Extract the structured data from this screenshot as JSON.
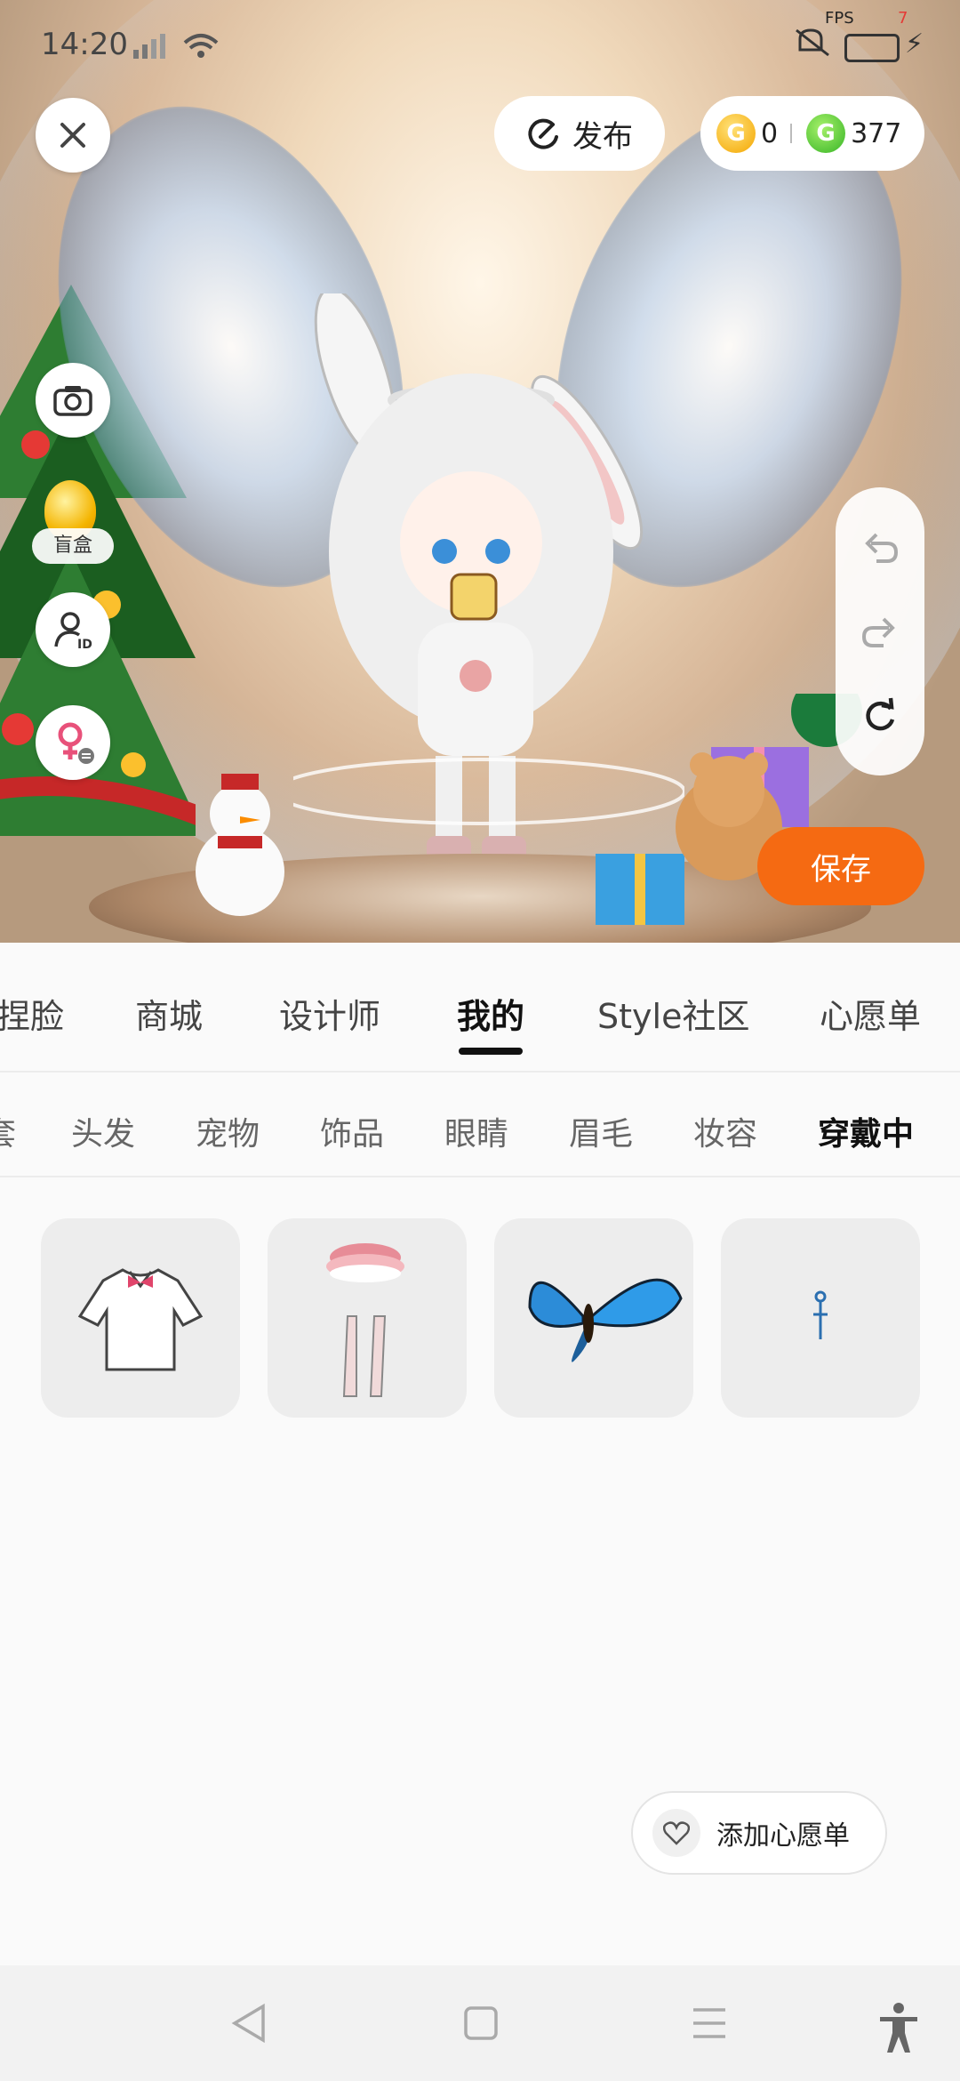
{
  "status_bar": {
    "time": "14:20",
    "fps_label": "FPS",
    "fps_value": "7"
  },
  "top_bar": {
    "publish_label": "发布",
    "gold_coin_value": "0",
    "green_coin_value": "377",
    "gold_coin_glyph": "G",
    "green_coin_glyph": "G"
  },
  "left_tools": {
    "blind_box_label": "盲盒"
  },
  "save_label": "保存",
  "main_tabs": [
    {
      "label": "捏脸"
    },
    {
      "label": "商城"
    },
    {
      "label": "设计师"
    },
    {
      "label": "我的"
    },
    {
      "label": "Style社区"
    },
    {
      "label": "心愿单"
    }
  ],
  "active_main_tab": "我的",
  "sub_tabs": [
    {
      "label": "套"
    },
    {
      "label": "头发"
    },
    {
      "label": "宠物"
    },
    {
      "label": "饰品"
    },
    {
      "label": "眼睛"
    },
    {
      "label": "眉毛"
    },
    {
      "label": "妆容"
    },
    {
      "label": "穿戴中"
    }
  ],
  "active_sub_tab": "穿戴中",
  "wearing_items": [
    {
      "icon": "white-shirt-icon"
    },
    {
      "icon": "skirt-and-stockings-icon"
    },
    {
      "icon": "butterfly-icon"
    },
    {
      "icon": "earring-icon"
    }
  ],
  "wishlist_button_label": "添加心愿单",
  "colors": {
    "accent_orange": "#f56a12",
    "gold_coin": "#f4a600",
    "green_coin": "#37b526"
  }
}
